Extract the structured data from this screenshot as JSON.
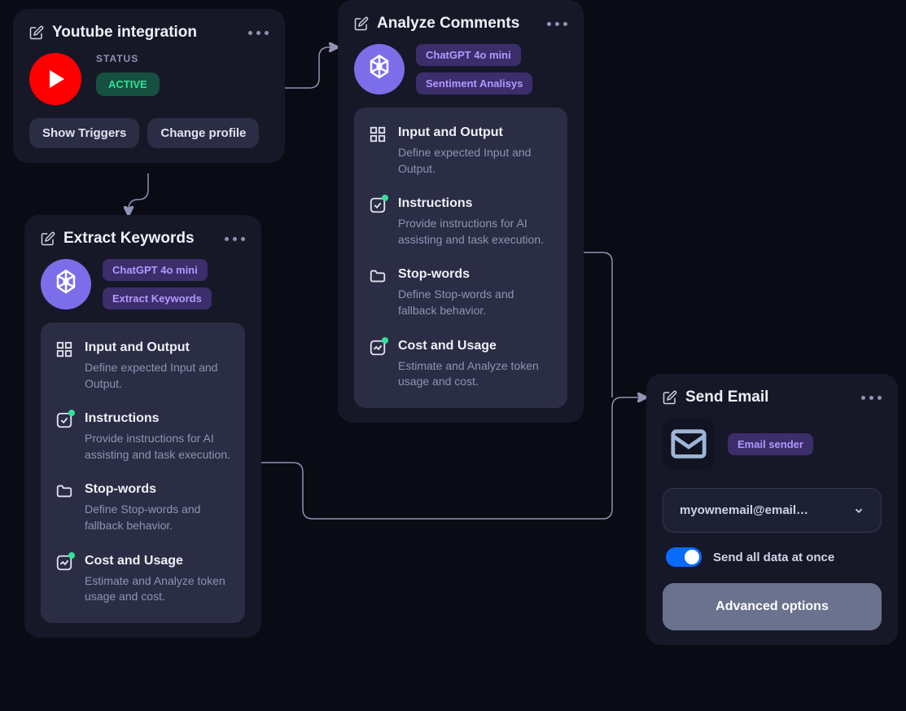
{
  "youtube": {
    "title": "Youtube integration",
    "status_label": "STATUS",
    "status_value": "ACTIVE",
    "show_triggers": "Show Triggers",
    "change_profile": "Change profile"
  },
  "extract": {
    "title": "Extract Keywords",
    "tag_model": "ChatGPT 4o mini",
    "tag_action": "Extract Keywords"
  },
  "analyze": {
    "title": "Analyze Comments",
    "tag_model": "ChatGPT 4o mini",
    "tag_action": "Sentiment Analisys"
  },
  "config_items": [
    {
      "title": "Input and Output",
      "desc": "Define expected Input and Output.",
      "icon": "grid"
    },
    {
      "title": "Instructions",
      "desc": "Provide instructions for AI assisting and task execution.",
      "icon": "check-square",
      "dot": true
    },
    {
      "title": "Stop-words",
      "desc": "Define Stop-words and fallback behavior.",
      "icon": "folder"
    },
    {
      "title": "Cost and Usage",
      "desc": "Estimate and Analyze token usage and cost.",
      "icon": "chart",
      "dot": true
    }
  ],
  "email": {
    "title": "Send Email",
    "tag": "Email sender",
    "selected": "myownemail@email…",
    "toggle_label": "Send all data at once",
    "advanced": "Advanced options"
  }
}
